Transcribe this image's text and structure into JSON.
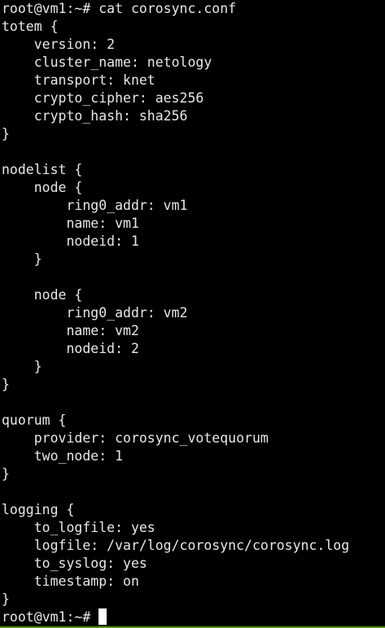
{
  "terminal": {
    "prompt": "root@vm1:~# ",
    "command": "cat corosync.conf",
    "output": [
      "totem {",
      "    version: 2",
      "    cluster_name: netology",
      "    transport: knet",
      "    crypto_cipher: aes256",
      "    crypto_hash: sha256",
      "}",
      "",
      "nodelist {",
      "    node {",
      "        ring0_addr: vm1",
      "        name: vm1",
      "        nodeid: 1",
      "    }",
      "",
      "    node {",
      "        ring0_addr: vm2",
      "        name: vm2",
      "        nodeid: 2",
      "    }",
      "}",
      "",
      "quorum {",
      "    provider: corosync_votequorum",
      "    two_node: 1",
      "}",
      "",
      "logging {",
      "    to_logfile: yes",
      "    logfile: /var/log/corosync/corosync.log",
      "    to_syslog: yes",
      "    timestamp: on",
      "}"
    ],
    "final_prompt": "root@vm1:~# "
  },
  "colors": {
    "background": "#000000",
    "foreground": "#e8e8e8",
    "cursor": "#ffffff",
    "status_bar": "#4e9a06"
  }
}
